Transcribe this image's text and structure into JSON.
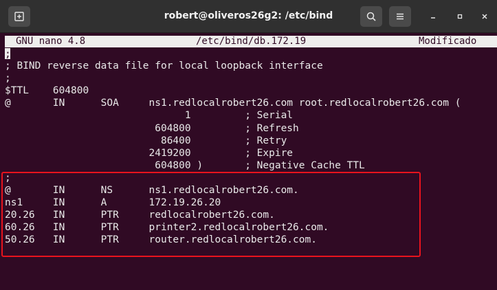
{
  "window": {
    "title": "robert@oliveros26g2: /etc/bind"
  },
  "icons": {
    "new_tab": "new-tab-icon",
    "search": "search-icon",
    "menu": "hamburger-menu-icon",
    "minimize": "minimize-icon",
    "maximize": "maximize-icon",
    "close": "close-icon"
  },
  "nano": {
    "version": "GNU nano 4.8",
    "filename": "/etc/bind/db.172.19",
    "status": "Modificado"
  },
  "file_lines": [
    "",
    "; BIND reverse data file for local loopback interface",
    ";",
    "$TTL    604800",
    "@       IN      SOA     ns1.redlocalrobert26.com root.redlocalrobert26.com (",
    "                              1         ; Serial",
    "                         604800         ; Refresh",
    "                          86400         ; Retry",
    "                        2419200         ; Expire",
    "                         604800 )       ; Negative Cache TTL",
    ";",
    "@       IN      NS      ns1.redlocalrobert26.com.",
    "ns1     IN      A       172.19.26.20",
    "20.26   IN      PTR     redlocalrobert26.com.",
    "60.26   IN      PTR     printer2.redlocalrobert26.com.",
    "50.26   IN      PTR     router.redlocalrobert26.com."
  ],
  "cursor_char": ";",
  "colors": {
    "terminal_bg": "#300a24",
    "titlebar_bg": "#303030",
    "highlight": "#e8131d"
  }
}
